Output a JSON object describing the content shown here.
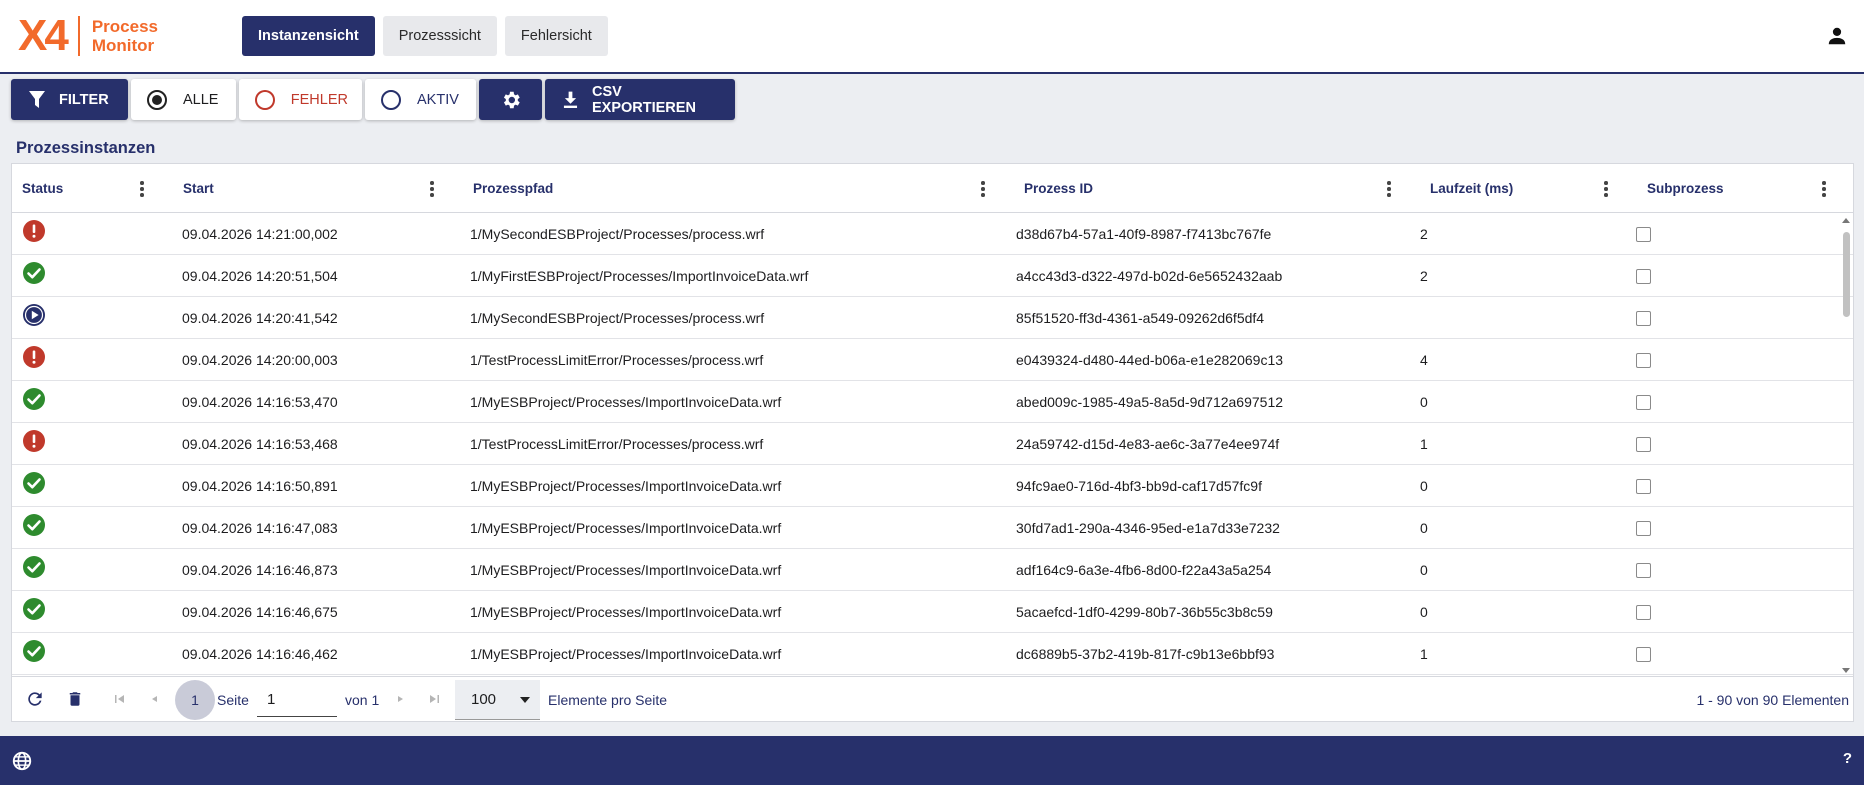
{
  "app": {
    "logo_mark": "X4",
    "logo_line1": "Process",
    "logo_line2": "Monitor"
  },
  "nav": {
    "tabs": [
      {
        "label": "Instanzensicht",
        "active": true
      },
      {
        "label": "Prozesssicht",
        "active": false
      },
      {
        "label": "Fehlersicht",
        "active": false
      }
    ]
  },
  "toolbar": {
    "filter_label": "FILTER",
    "all_label": "ALLE",
    "error_label": "FEHLER",
    "active_label": "AKTIV",
    "export_label": "CSV EXPORTIEREN"
  },
  "section": {
    "title": "Prozessinstanzen"
  },
  "columns": [
    "Status",
    "Start",
    "Prozesspfad",
    "Prozess ID",
    "Laufzeit (ms)",
    "Subprozess"
  ],
  "rows": [
    {
      "status": "error",
      "start": "09.04.2026 14:21:00,002",
      "path": "1/MySecondESBProject/Processes/process.wrf",
      "id": "d38d67b4-57a1-40f9-8987-f7413bc767fe",
      "runtime": "2",
      "subprocess": false
    },
    {
      "status": "success",
      "start": "09.04.2026 14:20:51,504",
      "path": "1/MyFirstESBProject/Processes/ImportInvoiceData.wrf",
      "id": "a4cc43d3-d322-497d-b02d-6e5652432aab",
      "runtime": "2",
      "subprocess": false
    },
    {
      "status": "running",
      "start": "09.04.2026 14:20:41,542",
      "path": "1/MySecondESBProject/Processes/process.wrf",
      "id": "85f51520-ff3d-4361-a549-09262d6f5df4",
      "runtime": "",
      "subprocess": false
    },
    {
      "status": "error",
      "start": "09.04.2026 14:20:00,003",
      "path": "1/TestProcessLimitError/Processes/process.wrf",
      "id": "e0439324-d480-44ed-b06a-e1e282069c13",
      "runtime": "4",
      "subprocess": false
    },
    {
      "status": "success",
      "start": "09.04.2026 14:16:53,470",
      "path": "1/MyESBProject/Processes/ImportInvoiceData.wrf",
      "id": "abed009c-1985-49a5-8a5d-9d712a697512",
      "runtime": "0",
      "subprocess": false
    },
    {
      "status": "error",
      "start": "09.04.2026 14:16:53,468",
      "path": "1/TestProcessLimitError/Processes/process.wrf",
      "id": "24a59742-d15d-4e83-ae6c-3a77e4ee974f",
      "runtime": "1",
      "subprocess": false
    },
    {
      "status": "success",
      "start": "09.04.2026 14:16:50,891",
      "path": "1/MyESBProject/Processes/ImportInvoiceData.wrf",
      "id": "94fc9ae0-716d-4bf3-bb9d-caf17d57fc9f",
      "runtime": "0",
      "subprocess": false
    },
    {
      "status": "success",
      "start": "09.04.2026 14:16:47,083",
      "path": "1/MyESBProject/Processes/ImportInvoiceData.wrf",
      "id": "30fd7ad1-290a-4346-95ed-e1a7d33e7232",
      "runtime": "0",
      "subprocess": false
    },
    {
      "status": "success",
      "start": "09.04.2026 14:16:46,873",
      "path": "1/MyESBProject/Processes/ImportInvoiceData.wrf",
      "id": "adf164c9-6a3e-4fb6-8d00-f22a43a5a254",
      "runtime": "0",
      "subprocess": false
    },
    {
      "status": "success",
      "start": "09.04.2026 14:16:46,675",
      "path": "1/MyESBProject/Processes/ImportInvoiceData.wrf",
      "id": "5acaefcd-1df0-4299-80b7-36b55c3b8c59",
      "runtime": "0",
      "subprocess": false
    },
    {
      "status": "success",
      "start": "09.04.2026 14:16:46,462",
      "path": "1/MyESBProject/Processes/ImportInvoiceData.wrf",
      "id": "dc6889b5-37b2-419b-817f-c9b13e6bbf93",
      "runtime": "1",
      "subprocess": false
    }
  ],
  "pager": {
    "current_page": "1",
    "page_label": "Seite",
    "page_input": "1",
    "of_label": "von 1",
    "page_size": "100",
    "page_size_label": "Elemente pro Seite",
    "summary": "1 - 90 von 90 Elementen"
  },
  "footer": {
    "help": "?"
  },
  "colors": {
    "primary": "#27306b",
    "accent": "#f26a2b",
    "error": "#c0392b",
    "success": "#2e8b2e"
  },
  "icons": {
    "filter": "filter-icon",
    "settings": "gear-icon",
    "export": "download-icon",
    "user": "user-icon",
    "language": "globe-icon",
    "refresh": "refresh-icon",
    "delete": "trash-icon"
  }
}
